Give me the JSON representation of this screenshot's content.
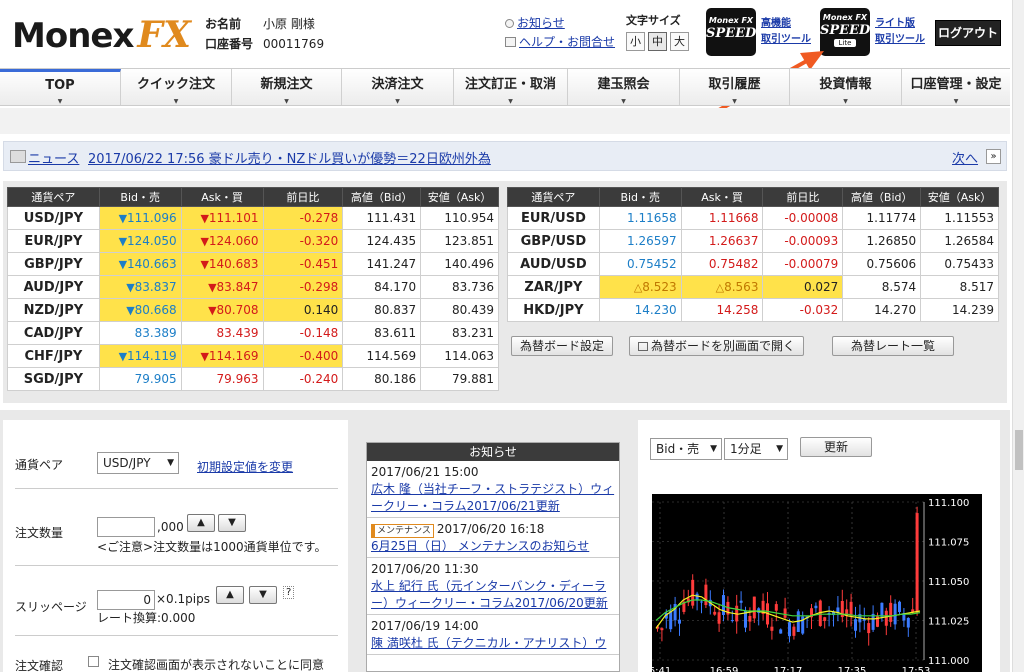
{
  "header": {
    "logo_main": "Monex",
    "logo_accent": "FX",
    "name_label": "お名前",
    "name_value": "小原 剛様",
    "account_label": "口座番号",
    "account_value": "00011769",
    "notice_link": "お知らせ",
    "help_link": "ヘルプ・お問合せ",
    "font_size_label": "文字サイズ",
    "font_sizes": [
      "小",
      "中",
      "大"
    ],
    "font_size_selected": "中",
    "app1": {
      "brand": "Monex FX",
      "name": "SPEED",
      "link1": "高機能",
      "link2": "取引ツール"
    },
    "app2": {
      "brand": "Monex FX",
      "name": "SPEED",
      "badge": "Lite",
      "link1": "ライト版",
      "link2": "取引ツール"
    },
    "logout": "ログアウト",
    "arrow_color": "#f05a22"
  },
  "nav": [
    "TOP",
    "クイック注文",
    "新規注文",
    "決済注文",
    "注文訂正・取消",
    "建玉照会",
    "取引履歴",
    "投資情報",
    "口座管理・設定"
  ],
  "news": {
    "label": "ニュース",
    "headline": "2017/06/22 17:56 豪ドル売り・NZドル買いが優勢＝22日欧州外為",
    "next": "次へ"
  },
  "rates": {
    "headers": [
      "通貨ペア",
      "Bid・売",
      "Ask・買",
      "前日比",
      "高値（Bid）",
      "安値（Ask）"
    ],
    "left": [
      {
        "pair": "USD/JPY",
        "bid": "111.096",
        "ask": "111.101",
        "chg": "-0.278",
        "high": "111.431",
        "low": "110.954",
        "dir": "dn",
        "hl": true
      },
      {
        "pair": "EUR/JPY",
        "bid": "124.050",
        "ask": "124.060",
        "chg": "-0.320",
        "high": "124.435",
        "low": "123.851",
        "dir": "dn",
        "hl": true
      },
      {
        "pair": "GBP/JPY",
        "bid": "140.663",
        "ask": "140.683",
        "chg": "-0.451",
        "high": "141.247",
        "low": "140.496",
        "dir": "dn",
        "hl": true
      },
      {
        "pair": "AUD/JPY",
        "bid": "83.837",
        "ask": "83.847",
        "chg": "-0.298",
        "high": "84.170",
        "low": "83.736",
        "dir": "dn",
        "hl": true
      },
      {
        "pair": "NZD/JPY",
        "bid": "80.668",
        "ask": "80.708",
        "chg": "0.140",
        "high": "80.837",
        "low": "80.439",
        "dir": "dn",
        "hl": true
      },
      {
        "pair": "CAD/JPY",
        "bid": "83.389",
        "ask": "83.439",
        "chg": "-0.148",
        "high": "83.611",
        "low": "83.231",
        "dir": "",
        "hl": false
      },
      {
        "pair": "CHF/JPY",
        "bid": "114.119",
        "ask": "114.169",
        "chg": "-0.400",
        "high": "114.569",
        "low": "114.063",
        "dir": "dn",
        "hl": true
      },
      {
        "pair": "SGD/JPY",
        "bid": "79.905",
        "ask": "79.963",
        "chg": "-0.240",
        "high": "80.186",
        "low": "79.881",
        "dir": "",
        "hl": false
      }
    ],
    "right": [
      {
        "pair": "EUR/USD",
        "bid": "1.11658",
        "ask": "1.11668",
        "chg": "-0.00008",
        "high": "1.11774",
        "low": "1.11553",
        "dir": "",
        "hl": false
      },
      {
        "pair": "GBP/USD",
        "bid": "1.26597",
        "ask": "1.26637",
        "chg": "-0.00093",
        "high": "1.26850",
        "low": "1.26584",
        "dir": "",
        "hl": false
      },
      {
        "pair": "AUD/USD",
        "bid": "0.75452",
        "ask": "0.75482",
        "chg": "-0.00079",
        "high": "0.75606",
        "low": "0.75433",
        "dir": "",
        "hl": false
      },
      {
        "pair": "ZAR/JPY",
        "bid": "8.523",
        "ask": "8.563",
        "chg": "0.027",
        "high": "8.574",
        "low": "8.517",
        "dir": "tri",
        "hl": true
      },
      {
        "pair": "HKD/JPY",
        "bid": "14.230",
        "ask": "14.258",
        "chg": "-0.032",
        "high": "14.270",
        "low": "14.239",
        "dir": "",
        "hl": false
      }
    ],
    "buttons": [
      "為替ボード設定",
      "為替ボードを別画面で開く",
      "為替レート一覧"
    ]
  },
  "order": {
    "pair_label": "通貨ペア",
    "pair_value": "USD/JPY",
    "init_link": "初期設定値を変更",
    "qty_label": "注文数量",
    "qty_suffix": ",000",
    "qty_note": "<ご注意>注文数量は1000通貨単位です。",
    "slip_label": "スリッページ",
    "slip_value": "0",
    "slip_unit": "×0.1pips",
    "rate_conv": "レート換算:0.000",
    "confirm_label": "注文確認",
    "confirm_text": "注文確認画面が表示されないことに同意"
  },
  "notices": {
    "title": "お知らせ",
    "items": [
      {
        "date": "2017/06/21 15:00",
        "tag": "",
        "link": "広木 隆（当社チーフ・ストラテジスト）ウィークリー・コラム2017/06/21更新"
      },
      {
        "date": "2017/06/20 16:18",
        "tag": "メンテナンス",
        "link": "6月25日（日） メンテナンスのお知らせ"
      },
      {
        "date": "2017/06/20 11:30",
        "tag": "",
        "link": "水上 紀行 氏（元インターバンク・ディーラー）ウィークリー・コラム2017/06/20更新"
      },
      {
        "date": "2017/06/19 14:00",
        "tag": "",
        "link": "陳 満咲杜 氏（テクニカル・アナリスト）ウ"
      }
    ]
  },
  "chart_panel": {
    "side": "Bid・売",
    "interval": "1分足",
    "refresh": "更新"
  },
  "chart_data": {
    "type": "line",
    "x_ticks": [
      "6:41",
      "16:59",
      "17:17",
      "17:35",
      "17:53"
    ],
    "y_ticks": [
      "111.100",
      "111.075",
      "111.050",
      "111.025",
      "111.000"
    ],
    "ylim": [
      111.0,
      111.1
    ],
    "series": [
      {
        "color": "#f5f520",
        "values": [
          111.02,
          111.028,
          111.032,
          111.038,
          111.041,
          111.04,
          111.036,
          111.032,
          111.03,
          111.029,
          111.03,
          111.031,
          111.03,
          111.028,
          111.026,
          111.024,
          111.025,
          111.028,
          111.03,
          111.031,
          111.03,
          111.028,
          111.027,
          111.026,
          111.026,
          111.027,
          111.028,
          111.029,
          111.03,
          111.031
        ]
      },
      {
        "color": "#3fd63f",
        "values": [
          111.025,
          111.03,
          111.033,
          111.036,
          111.038,
          111.038,
          111.037,
          111.035,
          111.033,
          111.032,
          111.031,
          111.031,
          111.031,
          111.03,
          111.029,
          111.028,
          111.028,
          111.028,
          111.029,
          111.029,
          111.029,
          111.029,
          111.028,
          111.028,
          111.028,
          111.028,
          111.028,
          111.029,
          111.029,
          111.03
        ]
      }
    ]
  }
}
